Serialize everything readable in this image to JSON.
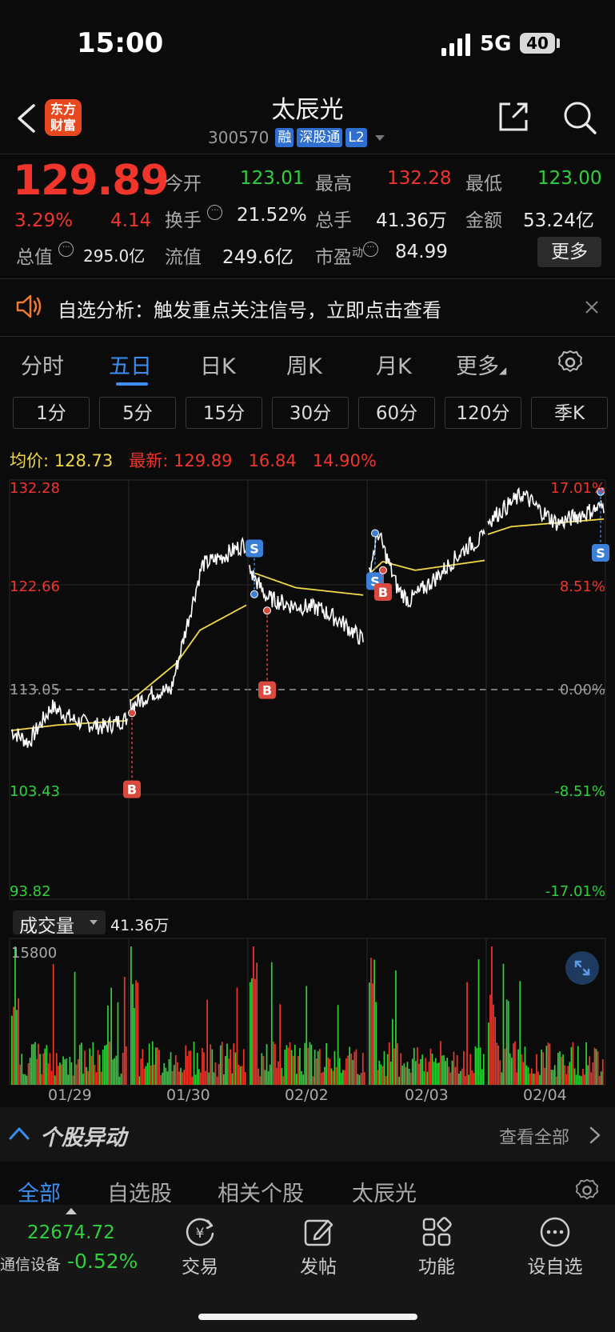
{
  "status_bar": {
    "time": "15:00",
    "network": "5G",
    "battery": "40"
  },
  "header": {
    "title": "太辰光",
    "code": "300570",
    "tags": [
      "融",
      "深股通",
      "L2"
    ],
    "logo": "东方\n财富"
  },
  "quote": {
    "price": "129.89",
    "change_pct": "3.29%",
    "change": "4.14",
    "stats": [
      {
        "label": "今开",
        "value": "123.01",
        "color": "green"
      },
      {
        "label": "最高",
        "value": "132.28",
        "color": "red"
      },
      {
        "label": "最低",
        "value": "123.00",
        "color": "green"
      },
      {
        "label": "换手",
        "value": "21.52%",
        "color": "white"
      },
      {
        "label": "总手",
        "value": "41.36万",
        "color": "white"
      },
      {
        "label": "金额",
        "value": "53.24亿",
        "color": "white"
      },
      {
        "label": "总值",
        "value": "295.0亿",
        "color": "white"
      },
      {
        "label": "流值",
        "value": "249.6亿",
        "color": "white"
      },
      {
        "label": "市盈",
        "sup": "动",
        "value": "84.99",
        "color": "white"
      }
    ],
    "more_label": "更多"
  },
  "notice": {
    "text": "自选分析：触发重点关注信号，立即点击查看"
  },
  "period_tabs": [
    "分时",
    "五日",
    "日K",
    "周K",
    "月K",
    "更多"
  ],
  "active_tab": "五日",
  "interval_chips": [
    "1分",
    "5分",
    "15分",
    "30分",
    "60分",
    "120分",
    "季K"
  ],
  "avg_bar": {
    "avg_label": "均价:",
    "avg_value": "128.73",
    "latest_label": "最新:",
    "latest_value": "129.89",
    "latest_change": "16.84",
    "latest_pct": "14.90%"
  },
  "chart_data": {
    "type": "line",
    "y_labels_left": [
      "132.28",
      "122.66",
      "113.05",
      "103.43",
      "93.82"
    ],
    "y_labels_right": [
      "17.01%",
      "8.51%",
      "0.00%",
      "-8.51%",
      "-17.01%"
    ],
    "ylim": [
      93.82,
      132.28
    ],
    "x_labels": [
      "01/29",
      "01/30",
      "02/02",
      "02/03",
      "02/04"
    ],
    "markers": [
      "B",
      "S",
      "B",
      "S",
      "B",
      "S"
    ],
    "volume_label": "成交量",
    "volume_value": "41.36万",
    "volume_max_label": "15800",
    "series": [
      {
        "name": "price",
        "color": "#ffffff"
      },
      {
        "name": "avg",
        "color": "#f1d84a"
      }
    ]
  },
  "movement": {
    "title": "个股异动",
    "view_all": "查看全部"
  },
  "filter_tabs": [
    "全部",
    "自选股",
    "相关个股",
    "太辰光"
  ],
  "bottom_nav": {
    "index_value": "22674.72",
    "index_name": "通信设备",
    "index_change": "-0.52%",
    "items": [
      {
        "label": "交易",
        "icon": "trade-icon"
      },
      {
        "label": "发帖",
        "icon": "post-icon"
      },
      {
        "label": "功能",
        "icon": "apps-icon"
      },
      {
        "label": "设自选",
        "icon": "more-icon"
      }
    ]
  }
}
